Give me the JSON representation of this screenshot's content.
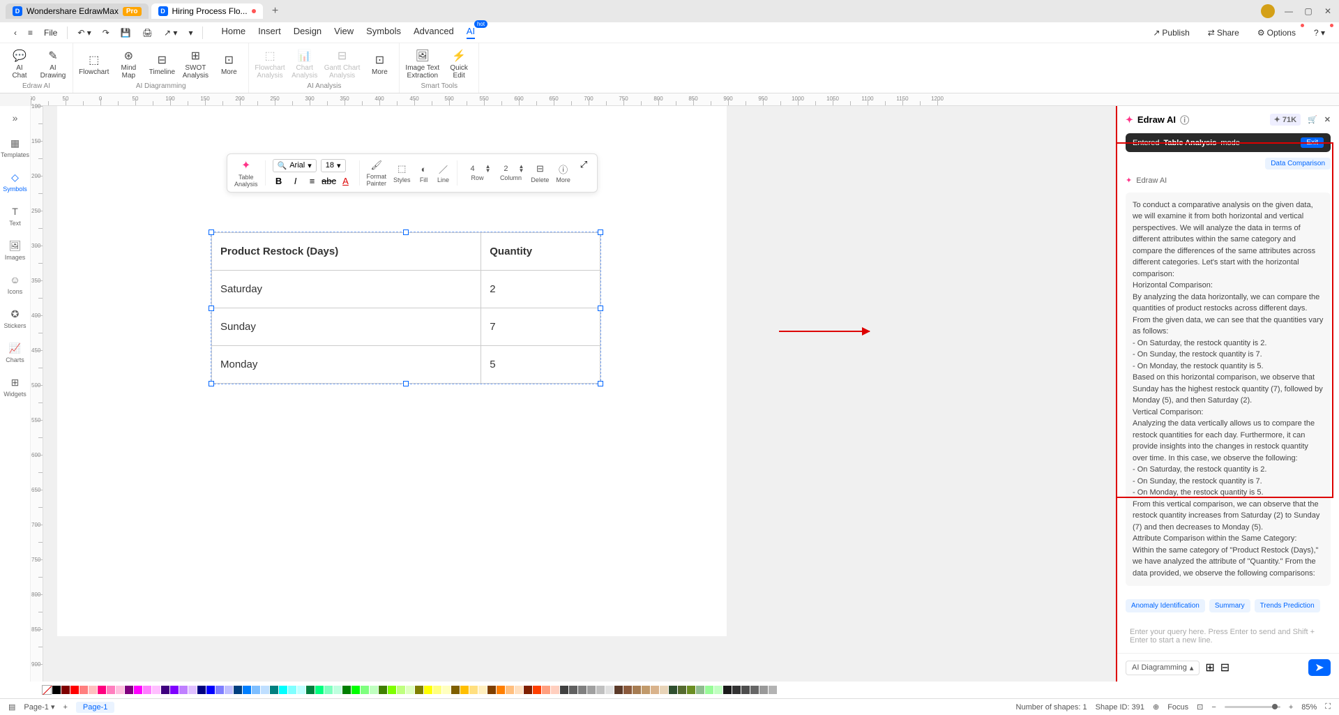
{
  "title_bar": {
    "app_name": "Wondershare EdrawMax",
    "pro": "Pro",
    "doc_name": "Hiring Process Flo..."
  },
  "toolbar": {
    "file": "File",
    "publish": "Publish",
    "share": "Share",
    "options": "Options"
  },
  "menu": {
    "home": "Home",
    "insert": "Insert",
    "design": "Design",
    "view": "View",
    "symbols": "Symbols",
    "advanced": "Advanced",
    "ai": "AI",
    "hot": "hot"
  },
  "ribbon": {
    "edraw_ai": {
      "ai_chat": "AI\nChat",
      "ai_drawing": "AI\nDrawing",
      "label": "Edraw AI"
    },
    "diagramming": {
      "flowchart": "Flowchart",
      "mindmap": "Mind\nMap",
      "timeline": "Timeline",
      "swot": "SWOT\nAnalysis",
      "more": "More",
      "label": "AI Diagramming"
    },
    "analysis": {
      "flowchart_a": "Flowchart\nAnalysis",
      "chart_a": "Chart\nAnalysis",
      "gantt_a": "Gantt Chart\nAnalysis",
      "more": "More",
      "label": "AI Analysis"
    },
    "smart": {
      "img_text": "Image Text\nExtraction",
      "quick": "Quick\nEdit",
      "label": "Smart Tools"
    }
  },
  "sidebar": {
    "templates": "Templates",
    "symbols": "Symbols",
    "text": "Text",
    "images": "Images",
    "icons": "Icons",
    "stickers": "Stickers",
    "charts": "Charts",
    "widgets": "Widgets"
  },
  "float_tb": {
    "table_analysis": "Table\nAnalysis",
    "font": "Arial",
    "size": "18",
    "format_painter": "Format\nPainter",
    "styles": "Styles",
    "fill": "Fill",
    "line": "Line",
    "row": "Row",
    "row_n": "4",
    "column": "Column",
    "col_n": "2",
    "delete": "Delete",
    "more": "More"
  },
  "table": {
    "headers": [
      "Product Restock (Days)",
      "Quantity"
    ],
    "rows": [
      [
        "Saturday",
        "2"
      ],
      [
        "Sunday",
        "7"
      ],
      [
        "Monday",
        "5"
      ]
    ]
  },
  "chart_data": {
    "type": "table",
    "title": "Product Restock (Days) vs Quantity",
    "columns": [
      "Product Restock (Days)",
      "Quantity"
    ],
    "rows": [
      {
        "Product Restock (Days)": "Saturday",
        "Quantity": 2
      },
      {
        "Product Restock (Days)": "Sunday",
        "Quantity": 7
      },
      {
        "Product Restock (Days)": "Monday",
        "Quantity": 5
      }
    ]
  },
  "ai_panel": {
    "title": "Edraw AI",
    "credits": "71K",
    "mode_pre": "Entered ",
    "mode_bold": "Table Analysis",
    "mode_post": " mode",
    "exit": "Exit",
    "tag": "Data Comparison",
    "author": "Edraw AI",
    "body": "To conduct a comparative analysis on the given data, we will examine it from both horizontal and vertical perspectives. We will analyze the data in terms of different attributes within the same category and compare the differences of the same attributes across different categories. Let's start with the horizontal comparison:\nHorizontal Comparison:\nBy analyzing the data horizontally, we can compare the quantities of product restocks across different days. From the given data, we can see that the quantities vary as follows:\n- On Saturday, the restock quantity is 2.\n- On Sunday, the restock quantity is 7.\n- On Monday, the restock quantity is 5.\nBased on this horizontal comparison, we observe that Sunday has the highest restock quantity (7), followed by Monday (5), and then Saturday (2).\nVertical Comparison:\nAnalyzing the data vertically allows us to compare the restock quantities for each day. Furthermore, it can provide insights into the changes in restock quantity over time. In this case, we observe the following:\n- On Saturday, the restock quantity is 2.\n- On Sunday, the restock quantity is 7.\n- On Monday, the restock quantity is 5.\nFrom this vertical comparison, we can observe that the restock quantity increases from Saturday (2) to Sunday (7) and then decreases to Monday (5).\nAttribute Comparison within the Same Category:\nWithin the same category of \"Product Restock (Days),\" we have analyzed the attribute of \"Quantity.\" From the data provided, we observe the following comparisons:",
    "sug1": "Anomaly Identification",
    "sug2": "Summary",
    "sug3": "Trends Prediction",
    "placeholder": "Enter your query here. Press Enter to send and Shift + Enter to start a new line.",
    "footer_mode": "AI Diagramming"
  },
  "status": {
    "page_tab": "Page-1",
    "page_tab2": "Page-1",
    "shapes": "Number of shapes: 1",
    "shape_id": "Shape ID: 391",
    "focus": "Focus",
    "zoom": "85%"
  },
  "colors": [
    "#000000",
    "#7f0000",
    "#ff0000",
    "#ff7f7f",
    "#ffbfbf",
    "#ff007f",
    "#ff7fbf",
    "#ffbfdf",
    "#7f007f",
    "#ff00ff",
    "#ff7fff",
    "#ffbfff",
    "#3f007f",
    "#7f00ff",
    "#bf7fff",
    "#dfbfff",
    "#00007f",
    "#0000ff",
    "#7f7fff",
    "#bfbfff",
    "#003f7f",
    "#007fff",
    "#7fbfff",
    "#bfdfff",
    "#007f7f",
    "#00ffff",
    "#7fffff",
    "#bfffff",
    "#007f3f",
    "#00ff7f",
    "#7fffbf",
    "#bfffdf",
    "#007f00",
    "#00ff00",
    "#7fff7f",
    "#bfffbf",
    "#3f7f00",
    "#7fff00",
    "#bfff7f",
    "#dfffbf",
    "#7f7f00",
    "#ffff00",
    "#ffff7f",
    "#ffffbf",
    "#7f5f00",
    "#ffbf00",
    "#ffdf7f",
    "#ffefbf",
    "#7f3f00",
    "#ff7f00",
    "#ffbf7f",
    "#ffdfbf",
    "#7f1f00",
    "#ff3f00",
    "#ff9f7f",
    "#ffcfbf",
    "#404040",
    "#606060",
    "#808080",
    "#a0a0a0",
    "#c0c0c0",
    "#e0e0e0",
    "#5b3a29",
    "#8b5a3c",
    "#a67c52",
    "#c19a6b",
    "#d9b38c",
    "#e8d4b8",
    "#2f4f2f",
    "#556b2f",
    "#6b8e23",
    "#8fbc8f",
    "#98fb98",
    "#c1ffc1",
    "#1a1a1a",
    "#333333",
    "#4d4d4d",
    "#666666",
    "#999999",
    "#b3b3b3"
  ]
}
